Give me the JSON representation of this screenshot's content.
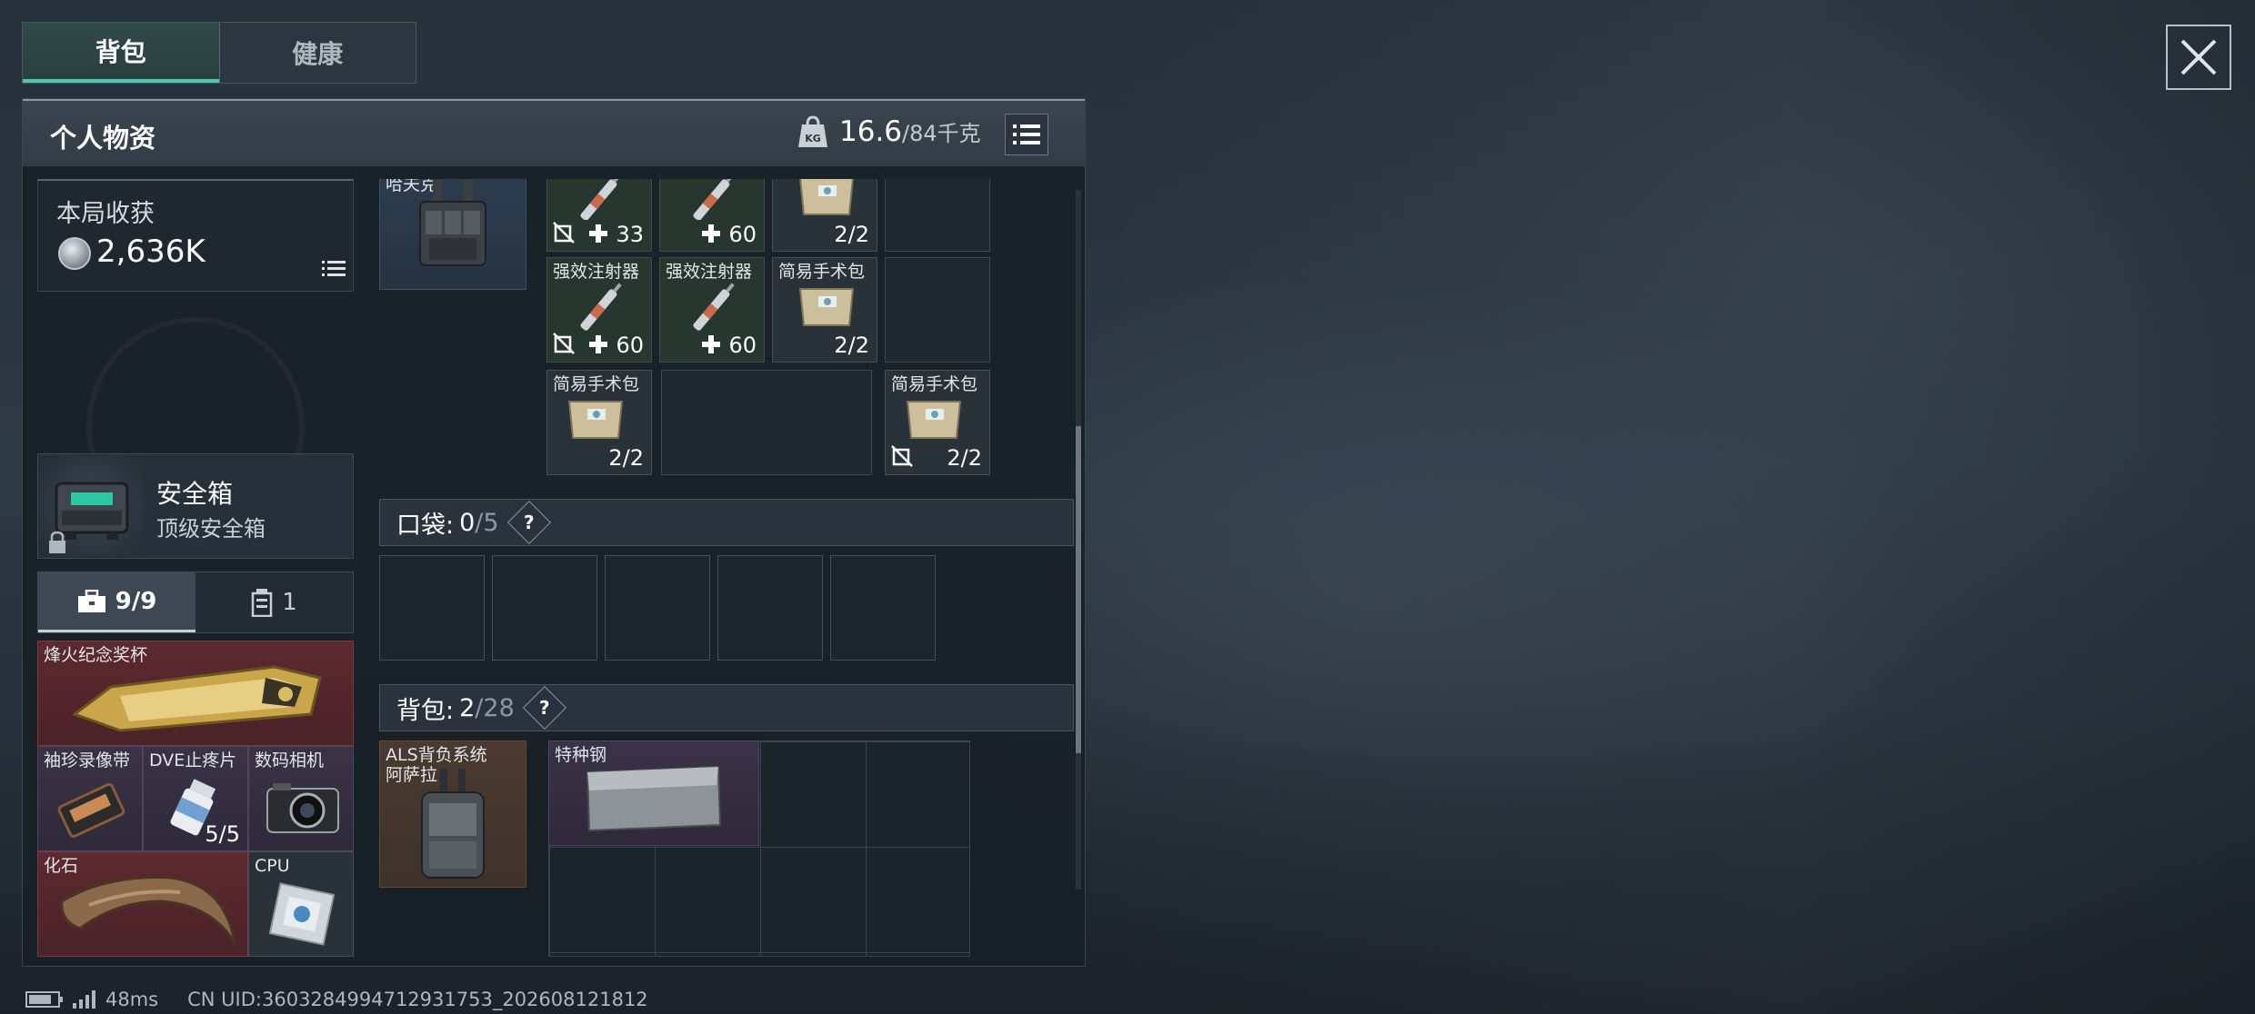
{
  "tabs": [
    {
      "label": "背包",
      "active": true
    },
    {
      "label": "健康",
      "active": false
    }
  ],
  "panel": {
    "title": "个人物资",
    "weight_current": "16.6",
    "weight_max": "/84千克",
    "weight_icon_text": "KG"
  },
  "earnings": {
    "label": "本局收获",
    "value": "2,636K"
  },
  "safe_box": {
    "name": "安全箱",
    "subtitle": "顶级安全箱"
  },
  "safe_tabs": [
    {
      "label": "9/9",
      "icon": "briefcase-icon"
    },
    {
      "label": "1",
      "icon": "canister-icon"
    }
  ],
  "safe_items": [
    {
      "name": "烽火纪念奖杯",
      "count": ""
    },
    {
      "name": "袖珍录像带",
      "count": ""
    },
    {
      "name": "DVE止疼片",
      "count": "5/5"
    },
    {
      "name": "数码相机",
      "count": ""
    },
    {
      "name": "化石",
      "count": ""
    },
    {
      "name": "CPU",
      "count": ""
    }
  ],
  "vest": {
    "name": "哈夫克"
  },
  "rig_items": [
    {
      "name": "",
      "mod": "33",
      "count": "",
      "no_carry": true
    },
    {
      "name": "",
      "mod": "60",
      "count": "",
      "no_carry": false
    },
    {
      "name": "",
      "mod": "",
      "count": "2/2",
      "no_carry": false
    },
    {
      "name": "强效注射器",
      "mod": "60",
      "count": "",
      "no_carry": true
    },
    {
      "name": "强效注射器",
      "mod": "60",
      "count": "",
      "no_carry": false
    },
    {
      "name": "简易手术包",
      "mod": "",
      "count": "2/2",
      "no_carry": false
    },
    {
      "name": "简易手术包",
      "mod": "",
      "count": "2/2",
      "no_carry": false
    },
    {
      "name": "简易手术包",
      "mod": "",
      "count": "2/2",
      "no_carry": true
    }
  ],
  "pocket": {
    "label": "口袋:",
    "current": "0",
    "max": "/5",
    "help": "?"
  },
  "backpack": {
    "label": "背包:",
    "current": "2",
    "max": "/28",
    "help": "?"
  },
  "backpack_equipped": {
    "name_line1": "ALS背负系统",
    "name_line2": "阿萨拉"
  },
  "backpack_items": [
    {
      "name": "特种钢"
    }
  ],
  "status_bar": {
    "ping": "48ms",
    "uid": "CN UID:3603284994712931753_202608121812"
  },
  "colors": {
    "accent": "#4fc7a8",
    "red_rarity": "#5c2a30",
    "purple_rarity": "#3a3347",
    "green_rarity": "#27372f"
  }
}
